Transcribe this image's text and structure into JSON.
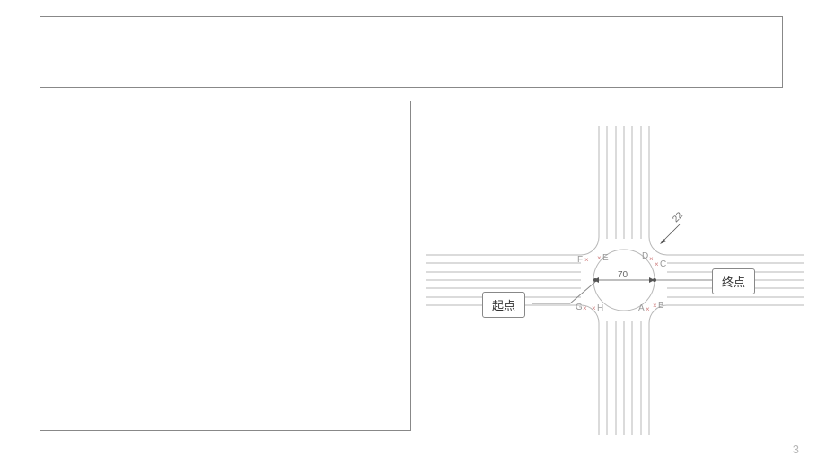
{
  "page": {
    "number": "3"
  },
  "dimensions": {
    "circle_diameter": "70",
    "corner_radius": "22"
  },
  "callouts": {
    "start": "起点",
    "end": "终点"
  },
  "points": {
    "A": "A",
    "B": "B",
    "C": "C",
    "D": "D",
    "E": "E",
    "F": "F",
    "G": "G",
    "H": "H"
  }
}
